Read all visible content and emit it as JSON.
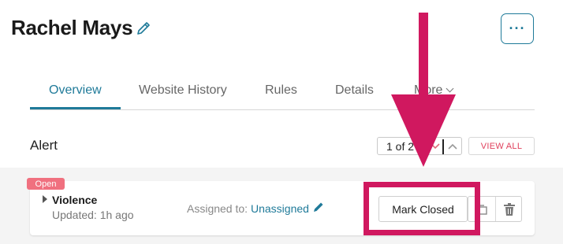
{
  "header": {
    "title": "Rachel Mays",
    "more_label": "···"
  },
  "tabs": [
    {
      "label": "Overview"
    },
    {
      "label": "Website History"
    },
    {
      "label": "Rules"
    },
    {
      "label": "Details"
    },
    {
      "label": "More"
    }
  ],
  "section": {
    "title": "Alert"
  },
  "pager": {
    "text": "1 of 2"
  },
  "view_all": "VIEW ALL",
  "alert": {
    "status": "Open",
    "name": "Violence",
    "updated": "Updated: 1h ago",
    "assigned_label": "Assigned to:",
    "assigned_value": "Unassigned",
    "mark_closed": "Mark Closed"
  },
  "colors": {
    "accent": "#1f7a99",
    "badge": "#f0707f",
    "annotation": "#d0185f",
    "view_all_text": "#e0405c"
  },
  "icons": [
    "pencil-icon",
    "more-dots-icon",
    "chevron-down-icon",
    "chevron-up-icon",
    "caret-right-icon",
    "snooze-icon",
    "trash-icon"
  ]
}
